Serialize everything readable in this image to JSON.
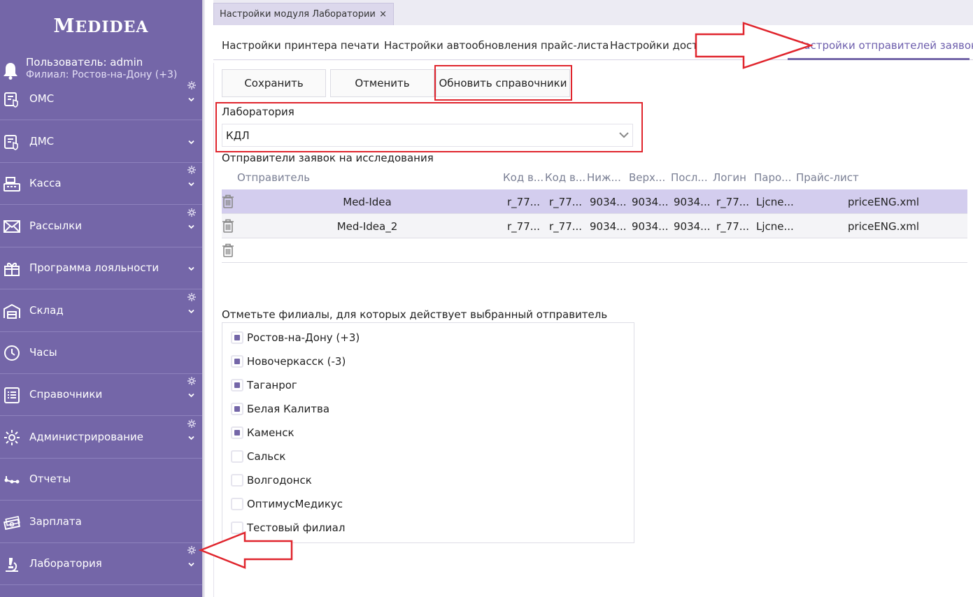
{
  "app": {
    "logo": {
      "first": "M",
      "rest": "EDIDEA",
      "first2": "I",
      "rest2": "DEA"
    },
    "user_label": "Пользователь: admin",
    "branch_label": "Филиал: Ростов-на-Дону (+3)"
  },
  "sidebar": {
    "items": [
      {
        "label": "ОМС",
        "icon": "oms-icon",
        "has_gear": true,
        "has_chevron": true
      },
      {
        "label": "ДМС",
        "icon": "dms-icon",
        "has_gear": false,
        "has_chevron": true
      },
      {
        "label": "Касса",
        "icon": "cash-register-icon",
        "has_gear": true,
        "has_chevron": true
      },
      {
        "label": "Рассылки",
        "icon": "envelope-icon",
        "has_gear": true,
        "has_chevron": true
      },
      {
        "label": "Программа лояльности",
        "icon": "gift-icon",
        "has_gear": false,
        "has_chevron": true
      },
      {
        "label": "Склад",
        "icon": "warehouse-icon",
        "has_gear": true,
        "has_chevron": true
      },
      {
        "label": "Часы",
        "icon": "clock-icon",
        "has_gear": false,
        "has_chevron": false
      },
      {
        "label": "Справочники",
        "icon": "list-icon",
        "has_gear": true,
        "has_chevron": true
      },
      {
        "label": "Администрирование",
        "icon": "settings-icon",
        "has_gear": true,
        "has_chevron": true
      },
      {
        "label": "Отчеты",
        "icon": "reports-icon",
        "has_gear": false,
        "has_chevron": false
      },
      {
        "label": "Зарплата",
        "icon": "money-icon",
        "has_gear": false,
        "has_chevron": false
      },
      {
        "label": "Лаборатория",
        "icon": "microscope-icon",
        "has_gear": true,
        "has_chevron": true
      }
    ]
  },
  "doc_tab": {
    "title": "Настройки модуля Лаборатории",
    "close": "×"
  },
  "settings_tabs": [
    {
      "label": "Настройки принтера печати",
      "active": false
    },
    {
      "label": "Настройки автообновления прайс-листа",
      "active": false
    },
    {
      "label": "Настройки доста",
      "active": false
    },
    {
      "label": "Настройки отправителей заявок",
      "active": true
    }
  ],
  "toolbar": {
    "save": "Сохранить",
    "cancel": "Отменить",
    "refresh": "Обновить справочники"
  },
  "lab": {
    "label": "Лаборатория",
    "value": "КДЛ"
  },
  "senders": {
    "title": "Отправители заявок на исследования",
    "columns": [
      "Отправитель",
      "Код в...",
      "Код в...",
      "Ниж...",
      "Верх...",
      "Посл...",
      "Логин",
      "Паро...",
      "Прайс-лист"
    ],
    "rows": [
      {
        "sender": "Med-Idea",
        "code1": "r_77...",
        "code2": "r_77...",
        "low": "9034...",
        "high": "9034...",
        "last": "9034...",
        "login": "r_77...",
        "password": "Ljcne...",
        "price": "priceENG.xml",
        "selected": true
      },
      {
        "sender": "Med-Idea_2",
        "code1": "r_77...",
        "code2": "r_77...",
        "low": "9034...",
        "high": "9034...",
        "last": "9034...",
        "login": "r_77...",
        "password": "Ljcne...",
        "price": "priceENG.xml",
        "selected": false
      },
      {
        "sender": "",
        "code1": "",
        "code2": "",
        "low": "",
        "high": "",
        "last": "",
        "login": "",
        "password": "",
        "price": "",
        "selected": false
      }
    ]
  },
  "branches": {
    "title": "Отметьте филиалы, для которых действует выбранный отправитель",
    "items": [
      {
        "label": "Ростов-на-Дону (+3)",
        "checked": true
      },
      {
        "label": "Новочеркасск (-3)",
        "checked": true
      },
      {
        "label": "Таганрог",
        "checked": true
      },
      {
        "label": "Белая Калитва",
        "checked": true
      },
      {
        "label": "Каменск",
        "checked": true
      },
      {
        "label": "Сальск",
        "checked": false
      },
      {
        "label": "Волгодонск",
        "checked": false
      },
      {
        "label": "ОптимусМедикус",
        "checked": false
      },
      {
        "label": "Тестовый филиал",
        "checked": false
      }
    ]
  },
  "colors": {
    "sidebar": "#7466a8",
    "accent": "#6e5fad",
    "highlight": "#e0252d",
    "selected_row": "#d3cdee"
  }
}
